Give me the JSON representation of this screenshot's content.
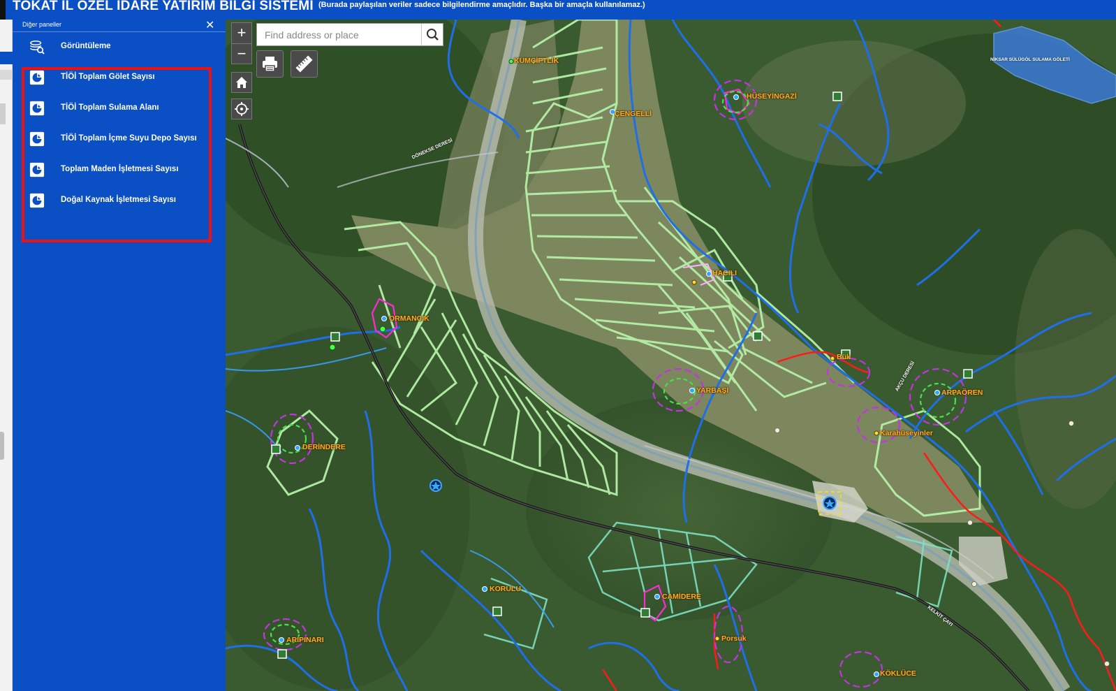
{
  "header": {
    "title": "TOKAT İL ÖZEL İDARE YATIRIM BİLGİ SİSTEMİ",
    "disclaimer": "(Burada paylaşılan veriler sadece bilgilendirme amaçlıdır. Başka bir amaçla kullanılamaz.)"
  },
  "panel": {
    "title": "Diğer paneller",
    "items": [
      {
        "label": "Görüntüleme",
        "icon": "layers-view-icon"
      },
      {
        "label": "TİÖİ Toplam Gölet Sayısı",
        "icon": "pie-chart-icon"
      },
      {
        "label": "TİÖİ Toplam Sulama Alanı",
        "icon": "pie-chart-icon"
      },
      {
        "label": "TİÖİ Toplam İçme Suyu Depo Sayısı",
        "icon": "pie-chart-icon"
      },
      {
        "label": "Toplam Maden İşletmesi Sayısı",
        "icon": "pie-chart-icon"
      },
      {
        "label": "Doğal Kaynak İşletmesi Sayısı",
        "icon": "pie-chart-icon"
      }
    ]
  },
  "map": {
    "zoom_in": "+",
    "zoom_out": "−",
    "search_placeholder": "Find address or place",
    "places": [
      {
        "name": "KUMÇİFTLİK"
      },
      {
        "name": "ÇENGELLİ"
      },
      {
        "name": "HÜSEYİNGAZİ"
      },
      {
        "name": "HACILI"
      },
      {
        "name": "ORMANCIK"
      },
      {
        "name": "Bük"
      },
      {
        "name": "YARBAŞI"
      },
      {
        "name": "ARPAÖREN"
      },
      {
        "name": "Karahüseyinler"
      },
      {
        "name": "DERİNDERE"
      },
      {
        "name": "KORULU"
      },
      {
        "name": "CAMİDERE"
      },
      {
        "name": "Porsuk"
      },
      {
        "name": "ARIPINARI"
      },
      {
        "name": "KÖKLÜCE"
      }
    ],
    "water_labels": [
      {
        "name": "DÖNEKSE DERESİ"
      },
      {
        "name": "AKÇU DERESİ"
      },
      {
        "name": "KELKİT ÇAYI"
      },
      {
        "name": "NİKSAR SÜLÜGÖL SULAMA GÖLETİ"
      }
    ],
    "colors": {
      "panel": "#0a4fc4",
      "highlight": "#ee1111",
      "river": "#1e6fe8",
      "parcel": "#b5f0a8",
      "road": "#1a1a1a"
    }
  }
}
